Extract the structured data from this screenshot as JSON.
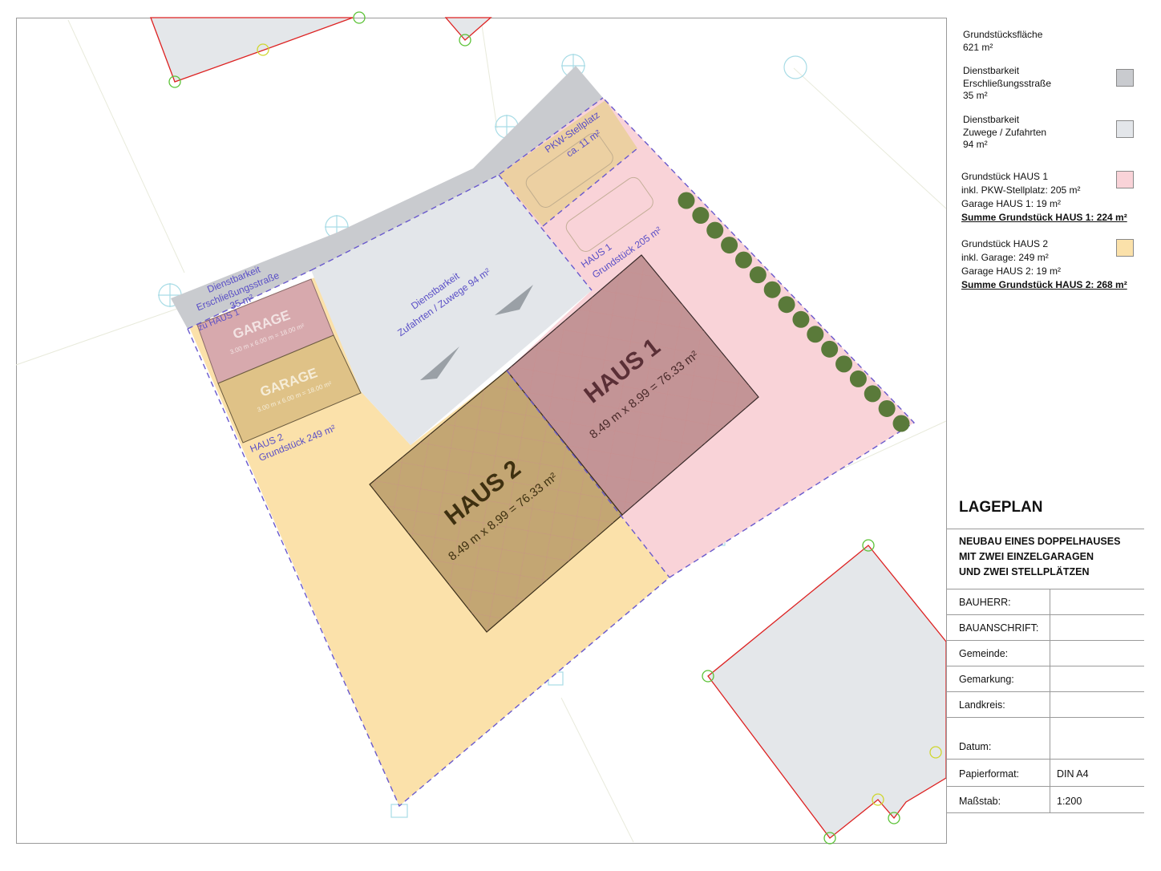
{
  "legend": {
    "area_label": "Grundstücksfläche",
    "area_value": "621 m²",
    "road_lines": [
      "Dienstbarkeit",
      "Erschließungsstraße",
      "35 m²"
    ],
    "access_lines": [
      "Dienstbarkeit",
      "Zuwege / Zufahrten",
      "94 m²"
    ],
    "haus1_lines": [
      "Grundstück HAUS 1",
      "inkl. PKW-Stellplatz: 205 m²",
      "Garage HAUS 1: 19 m²"
    ],
    "haus1_sum": "Summe Grundstück HAUS 1: 224 m²",
    "haus2_lines": [
      "Grundstück HAUS 2",
      "inkl. Garage: 249 m²",
      "Garage HAUS 2: 19 m²"
    ],
    "haus2_sum": "Summe Grundstück HAUS 2: 268 m²",
    "colors": {
      "road": "#c9cbcf",
      "access": "#e3e6ea",
      "haus1": "#f9d3d8",
      "haus2": "#fbe1aa"
    }
  },
  "title": {
    "heading": "LAGEPLAN",
    "project_lines": [
      "NEUBAU EINES DOPPELHAUSES",
      "MIT ZWEI EINZELGARAGEN",
      "UND ZWEI STELLPLÄTZEN"
    ]
  },
  "fields": [
    {
      "label": "BAUHERR:",
      "value": ""
    },
    {
      "label": "BAUANSCHRIFT:",
      "value": ""
    },
    {
      "label": "Gemeinde:",
      "value": ""
    },
    {
      "label": "Gemarkung:",
      "value": ""
    },
    {
      "label": "Landkreis:",
      "value": ""
    },
    {
      "label": "Datum:",
      "value": ""
    },
    {
      "label": "Papierformat:",
      "value": "DIN A4"
    },
    {
      "label": "Maßstab:",
      "value": "1:200"
    }
  ],
  "plan": {
    "haus1_title": "HAUS 1",
    "haus1_dims": "8.49 m x 8.99 = 76.33 m²",
    "haus2_title": "HAUS 2",
    "haus2_dims": "8.49 m x 8.99 = 76.33 m²",
    "garage_label": "GARAGE",
    "garage_dims": "3.00 m x 6.00 m = 18.00 m²",
    "road_label": [
      "Dienstbarkeit",
      "Erschließungsstraße",
      "35 m²"
    ],
    "access_label": [
      "Dienstbarkeit",
      "Zufahrten / Zuwege 94 m²"
    ],
    "parking_label": [
      "PKW-Stellplatz",
      "ca. 11 m²"
    ],
    "zu_haus1": "zu HAUS 1",
    "haus1_plot": [
      "HAUS 1",
      "Grundstück 205 m²"
    ],
    "haus2_plot": [
      "HAUS 2",
      "Grundstück 249 m²"
    ]
  }
}
